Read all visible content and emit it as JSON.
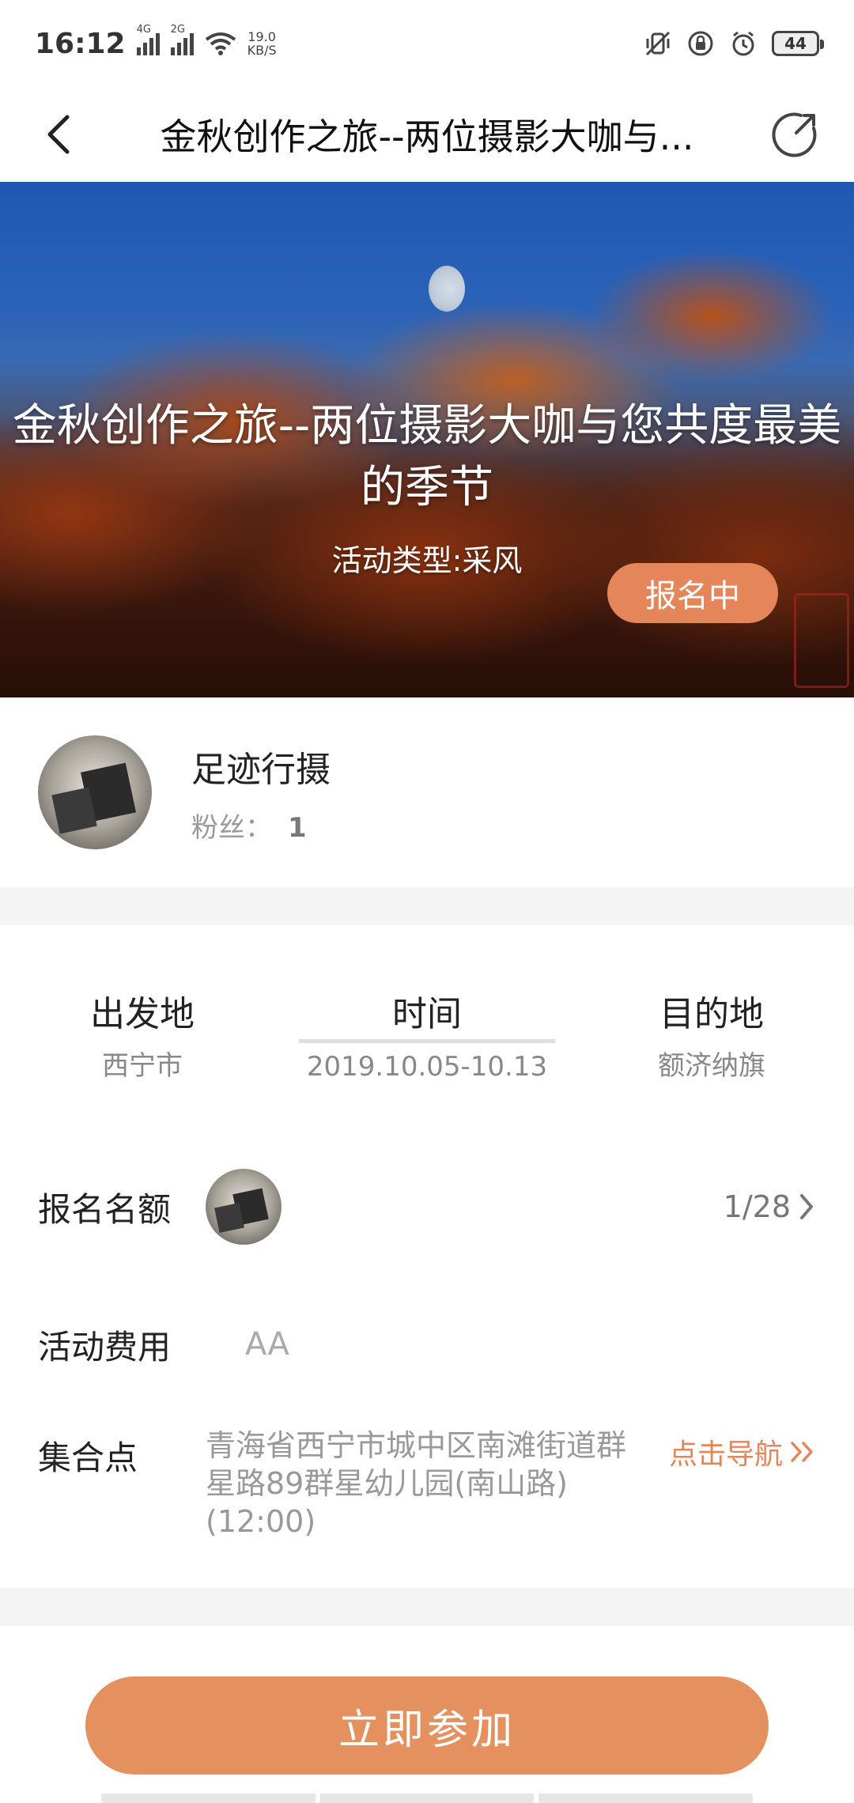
{
  "status_bar": {
    "time": "16:12",
    "signal_1_label": "4G",
    "signal_2_label": "2G",
    "net_speed_value": "19.0",
    "net_speed_unit": "KB/S",
    "battery": "44"
  },
  "nav": {
    "title": "金秋创作之旅--两位摄影大咖与..."
  },
  "banner": {
    "title": "金秋创作之旅--两位摄影大咖与您共度最美的季节",
    "activity_type": "活动类型:采风",
    "status": "报名中"
  },
  "organizer": {
    "name": "足迹行摄",
    "fans_label": "粉丝：",
    "fans_count": "1"
  },
  "trip": {
    "departure_label": "出发地",
    "departure_value": "西宁市",
    "time_label": "时间",
    "time_value": "2019.10.05-10.13",
    "destination_label": "目的地",
    "destination_value": "额济纳旗"
  },
  "quota": {
    "label": "报名名额",
    "value": "1/28"
  },
  "fee": {
    "label": "活动费用",
    "value": "AA"
  },
  "meeting": {
    "label": "集合点",
    "address": "青海省西宁市城中区南滩街道群星路89群星幼儿园(南山路)(12:00)",
    "navigate_label": "点击导航"
  },
  "join_button": "立即参加",
  "colors": {
    "accent": "#e4855a",
    "join_button": "#e4905f"
  }
}
